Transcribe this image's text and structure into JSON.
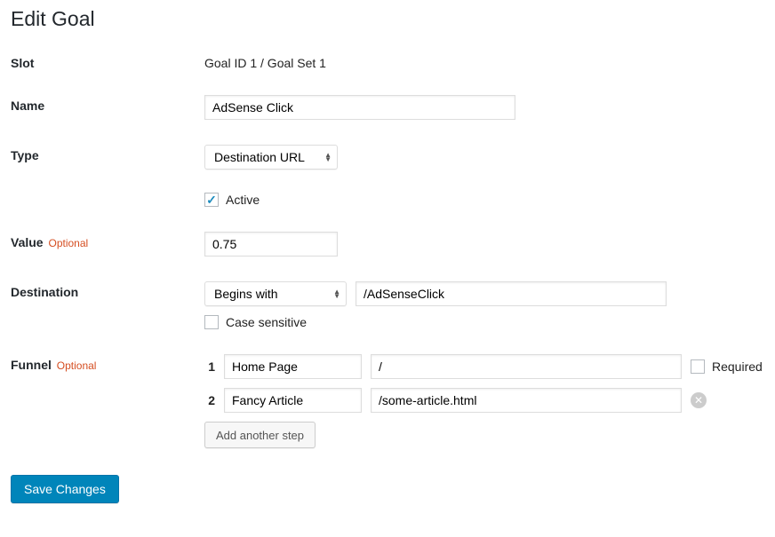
{
  "page_title": "Edit Goal",
  "labels": {
    "slot": "Slot",
    "name": "Name",
    "type": "Type",
    "value": "Value",
    "destination": "Destination",
    "funnel": "Funnel",
    "optional": "Optional",
    "active": "Active",
    "case_sensitive": "Case sensitive",
    "required": "Required",
    "add_step": "Add another step",
    "save": "Save Changes"
  },
  "slot_text": "Goal ID 1 / Goal Set 1",
  "name_value": "AdSense Click",
  "type_selected": "Destination URL",
  "active_checked": true,
  "value_value": "0.75",
  "destination_match": "Begins with",
  "destination_url": "/AdSenseClick",
  "case_sensitive_checked": false,
  "funnel_steps": [
    {
      "num": "1",
      "name": "Home Page",
      "url": "/",
      "required_visible": true,
      "required_checked": false,
      "removable": false
    },
    {
      "num": "2",
      "name": "Fancy Article",
      "url": "/some-article.html",
      "required_visible": false,
      "removable": true
    }
  ]
}
